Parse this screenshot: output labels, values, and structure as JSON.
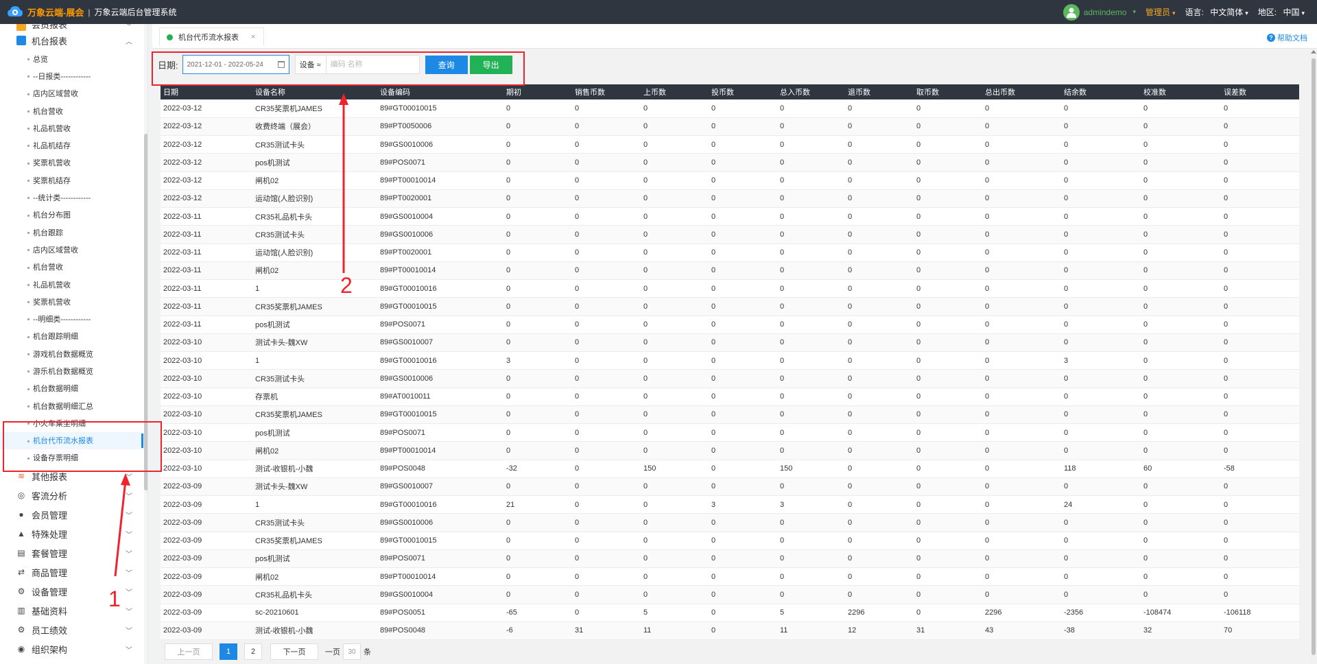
{
  "header": {
    "brand": "万象云端-展会",
    "separator": "|",
    "system_name": "万象云端后台管理系统",
    "username": "admindemo",
    "role": "管理员",
    "lang_label": "语言:",
    "lang_value": "中文简体",
    "region_label": "地区:",
    "region_value": "中国"
  },
  "sidebar": {
    "top_groups": [
      {
        "label": "会员报表",
        "icon": "member-report-icon"
      },
      {
        "label": "机台报表",
        "icon": "machine-report-icon"
      }
    ],
    "sub_items": [
      "总览",
      "--日报类------------",
      "店内区域营收",
      "机台营收",
      "礼品机营收",
      "礼品机结存",
      "奖票机营收",
      "奖票机结存",
      "--统计类------------",
      "机台分布图",
      "机台跟踪",
      "店内区域营收",
      "机台营收",
      "礼品机营收",
      "奖票机营收",
      "--明细类------------",
      "机台跟踪明细",
      "游戏机台数据概览",
      "游乐机台数据概览",
      "机台数据明细",
      "机台数据明细汇总",
      "小火车乘坐明细",
      "机台代币流水报表",
      "设备存票明细"
    ],
    "active_index": 22,
    "bottom_groups": [
      {
        "label": "其他报表",
        "icon": "layers-icon"
      },
      {
        "label": "客流分析",
        "icon": "target-icon"
      },
      {
        "label": "会员管理",
        "icon": "user-icon"
      },
      {
        "label": "特殊处理",
        "icon": "warning-icon"
      },
      {
        "label": "套餐管理",
        "icon": "package-icon"
      },
      {
        "label": "商品管理",
        "icon": "exchange-icon"
      },
      {
        "label": "设备管理",
        "icon": "device-icon"
      },
      {
        "label": "基础资料",
        "icon": "folder-icon"
      },
      {
        "label": "员工绩效",
        "icon": "gear-icon"
      },
      {
        "label": "组织架构",
        "icon": "org-icon"
      }
    ]
  },
  "tabbar": {
    "tab_label": "机台代币流水报表",
    "close": "×",
    "help": "帮助文档"
  },
  "filter": {
    "date_label": "日期:",
    "date_value": "2021-12-01 - 2022-05-24",
    "device_select": "设备 ≈",
    "code_placeholder": "编码 名称",
    "query": "查询",
    "export": "导出"
  },
  "table": {
    "columns": [
      "日期",
      "设备名称",
      "设备编码",
      "期初",
      "销售币数",
      "上币数",
      "投币数",
      "总入币数",
      "退币数",
      "取币数",
      "总出币数",
      "结余数",
      "校准数",
      "误差数"
    ],
    "rows": [
      [
        "2022-03-12",
        "CR35奖票机JAMES",
        "89#GT00010015",
        "0",
        "0",
        "0",
        "0",
        "0",
        "0",
        "0",
        "0",
        "0",
        "0",
        "0"
      ],
      [
        "2022-03-12",
        "收费终端（展会）",
        "89#PT0050006",
        "0",
        "0",
        "0",
        "0",
        "0",
        "0",
        "0",
        "0",
        "0",
        "0",
        "0"
      ],
      [
        "2022-03-12",
        "CR35测试卡头",
        "89#GS0010006",
        "0",
        "0",
        "0",
        "0",
        "0",
        "0",
        "0",
        "0",
        "0",
        "0",
        "0"
      ],
      [
        "2022-03-12",
        "pos机测试",
        "89#POS0071",
        "0",
        "0",
        "0",
        "0",
        "0",
        "0",
        "0",
        "0",
        "0",
        "0",
        "0"
      ],
      [
        "2022-03-12",
        "闸机02",
        "89#PT00010014",
        "0",
        "0",
        "0",
        "0",
        "0",
        "0",
        "0",
        "0",
        "0",
        "0",
        "0"
      ],
      [
        "2022-03-12",
        "运动馆(人脸识别)",
        "89#PT0020001",
        "0",
        "0",
        "0",
        "0",
        "0",
        "0",
        "0",
        "0",
        "0",
        "0",
        "0"
      ],
      [
        "2022-03-11",
        "CR35礼品机卡头",
        "89#GS0010004",
        "0",
        "0",
        "0",
        "0",
        "0",
        "0",
        "0",
        "0",
        "0",
        "0",
        "0"
      ],
      [
        "2022-03-11",
        "CR35测试卡头",
        "89#GS0010006",
        "0",
        "0",
        "0",
        "0",
        "0",
        "0",
        "0",
        "0",
        "0",
        "0",
        "0"
      ],
      [
        "2022-03-11",
        "运动馆(人脸识别)",
        "89#PT0020001",
        "0",
        "0",
        "0",
        "0",
        "0",
        "0",
        "0",
        "0",
        "0",
        "0",
        "0"
      ],
      [
        "2022-03-11",
        "闸机02",
        "89#PT00010014",
        "0",
        "0",
        "0",
        "0",
        "0",
        "0",
        "0",
        "0",
        "0",
        "0",
        "0"
      ],
      [
        "2022-03-11",
        "1",
        "89#GT00010016",
        "0",
        "0",
        "0",
        "0",
        "0",
        "0",
        "0",
        "0",
        "0",
        "0",
        "0"
      ],
      [
        "2022-03-11",
        "CR35奖票机JAMES",
        "89#GT00010015",
        "0",
        "0",
        "0",
        "0",
        "0",
        "0",
        "0",
        "0",
        "0",
        "0",
        "0"
      ],
      [
        "2022-03-11",
        "pos机测试",
        "89#POS0071",
        "0",
        "0",
        "0",
        "0",
        "0",
        "0",
        "0",
        "0",
        "0",
        "0",
        "0"
      ],
      [
        "2022-03-10",
        "测试卡头-魏XW",
        "89#GS0010007",
        "0",
        "0",
        "0",
        "0",
        "0",
        "0",
        "0",
        "0",
        "0",
        "0",
        "0"
      ],
      [
        "2022-03-10",
        "1",
        "89#GT00010016",
        "3",
        "0",
        "0",
        "0",
        "0",
        "0",
        "0",
        "0",
        "3",
        "0",
        "0"
      ],
      [
        "2022-03-10",
        "CR35测试卡头",
        "89#GS0010006",
        "0",
        "0",
        "0",
        "0",
        "0",
        "0",
        "0",
        "0",
        "0",
        "0",
        "0"
      ],
      [
        "2022-03-10",
        "存票机",
        "89#AT0010011",
        "0",
        "0",
        "0",
        "0",
        "0",
        "0",
        "0",
        "0",
        "0",
        "0",
        "0"
      ],
      [
        "2022-03-10",
        "CR35奖票机JAMES",
        "89#GT00010015",
        "0",
        "0",
        "0",
        "0",
        "0",
        "0",
        "0",
        "0",
        "0",
        "0",
        "0"
      ],
      [
        "2022-03-10",
        "pos机测试",
        "89#POS0071",
        "0",
        "0",
        "0",
        "0",
        "0",
        "0",
        "0",
        "0",
        "0",
        "0",
        "0"
      ],
      [
        "2022-03-10",
        "闸机02",
        "89#PT00010014",
        "0",
        "0",
        "0",
        "0",
        "0",
        "0",
        "0",
        "0",
        "0",
        "0",
        "0"
      ],
      [
        "2022-03-10",
        "测试-收银机-小魏",
        "89#POS0048",
        "-32",
        "0",
        "150",
        "0",
        "150",
        "0",
        "0",
        "0",
        "118",
        "60",
        "-58"
      ],
      [
        "2022-03-09",
        "测试卡头-魏XW",
        "89#GS0010007",
        "0",
        "0",
        "0",
        "0",
        "0",
        "0",
        "0",
        "0",
        "0",
        "0",
        "0"
      ],
      [
        "2022-03-09",
        "1",
        "89#GT00010016",
        "21",
        "0",
        "0",
        "3",
        "3",
        "0",
        "0",
        "0",
        "24",
        "0",
        "0"
      ],
      [
        "2022-03-09",
        "CR35测试卡头",
        "89#GS0010006",
        "0",
        "0",
        "0",
        "0",
        "0",
        "0",
        "0",
        "0",
        "0",
        "0",
        "0"
      ],
      [
        "2022-03-09",
        "CR35奖票机JAMES",
        "89#GT00010015",
        "0",
        "0",
        "0",
        "0",
        "0",
        "0",
        "0",
        "0",
        "0",
        "0",
        "0"
      ],
      [
        "2022-03-09",
        "pos机测试",
        "89#POS0071",
        "0",
        "0",
        "0",
        "0",
        "0",
        "0",
        "0",
        "0",
        "0",
        "0",
        "0"
      ],
      [
        "2022-03-09",
        "闸机02",
        "89#PT00010014",
        "0",
        "0",
        "0",
        "0",
        "0",
        "0",
        "0",
        "0",
        "0",
        "0",
        "0"
      ],
      [
        "2022-03-09",
        "CR35礼品机卡头",
        "89#GS0010004",
        "0",
        "0",
        "0",
        "0",
        "0",
        "0",
        "0",
        "0",
        "0",
        "0",
        "0"
      ],
      [
        "2022-03-09",
        "sc-20210601",
        "89#POS0051",
        "-65",
        "0",
        "5",
        "0",
        "5",
        "2296",
        "0",
        "2296",
        "-2356",
        "-108474",
        "-106118"
      ],
      [
        "2022-03-09",
        "测试-收银机-小魏",
        "89#POS0048",
        "-6",
        "31",
        "11",
        "0",
        "11",
        "12",
        "31",
        "43",
        "-38",
        "32",
        "70"
      ]
    ]
  },
  "pager": {
    "prev": "上一页",
    "pages": [
      "1",
      "2"
    ],
    "current": "1",
    "next": "下一页",
    "per_page_label": "一页",
    "per_page_value": "30",
    "per_page_unit": "条"
  },
  "annotations": {
    "label_1": "1",
    "label_2": "2",
    "color": "#f0232c"
  },
  "colors": {
    "topbar": "#2f3640",
    "accent": "#1e88e5",
    "export": "#21b156",
    "brand": "#ff9900"
  }
}
